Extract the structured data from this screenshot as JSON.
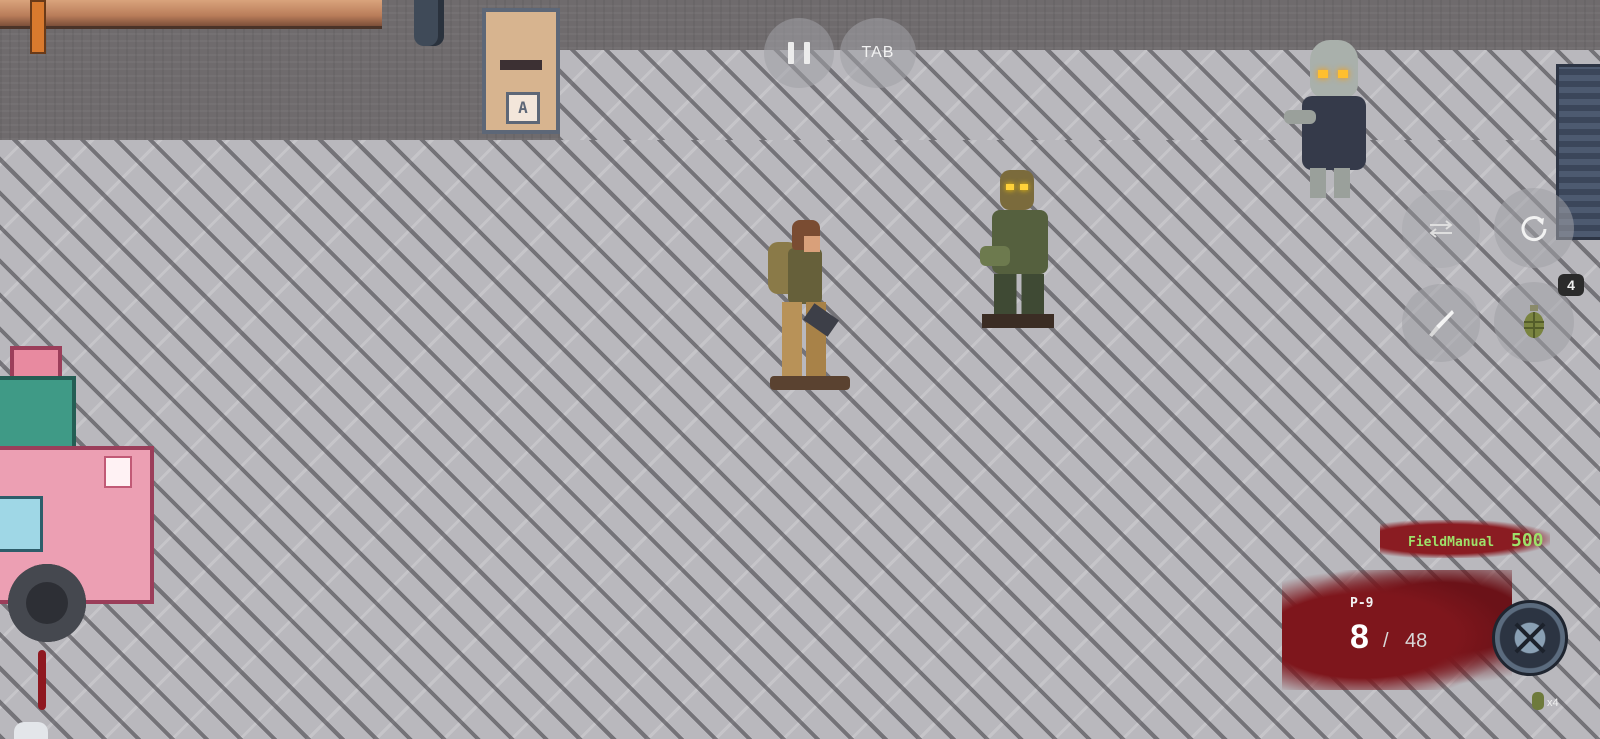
{
  "hud": {
    "pause_label": "",
    "tab_label": "TAB",
    "grenade_count": "4",
    "score": {
      "name": "FieldManual",
      "value": "500"
    },
    "weapon": {
      "name": "P-9",
      "ammo_current": "8",
      "separator": "/",
      "ammo_reserve": "48"
    },
    "grenade_stock": "x4"
  },
  "world": {
    "mailbox_sign": "A"
  },
  "icons": {
    "pause": "pause-icon",
    "swap": "swap-weapon-icon",
    "reload": "reload-icon",
    "knife": "knife-icon",
    "grenade": "grenade-icon",
    "compass": "compass-icon"
  },
  "colors": {
    "score_text": "#9ee06a",
    "blood": "#8a1c22",
    "zombie_eyes": "#ffcc00"
  }
}
